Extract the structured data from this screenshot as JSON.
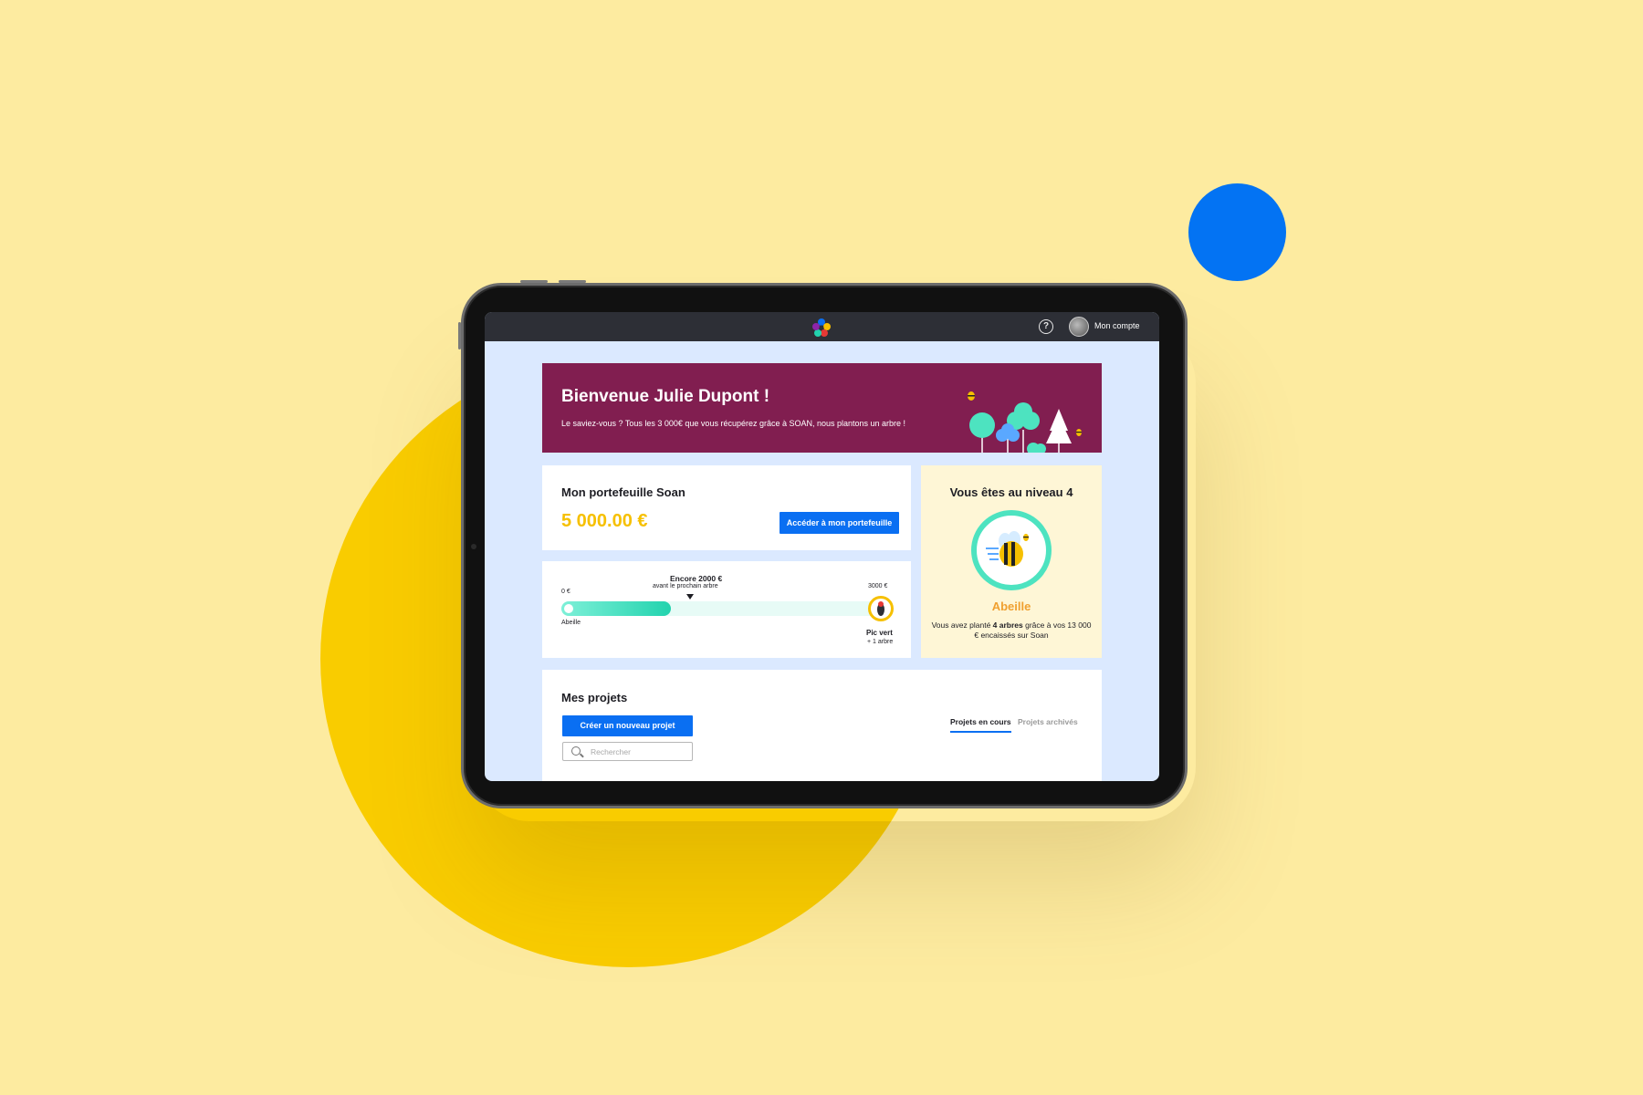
{
  "colors": {
    "background": "#fdeba0",
    "deco_yellow": "#f9cc00",
    "deco_blue": "#0373f3",
    "topbar": "#2d2f36",
    "banner": "#811e50",
    "accent_blue": "#0a6ff2",
    "amount_yellow": "#f6c000",
    "progress_green": "#22d3ae",
    "level_orange": "#f0a030",
    "level_card_bg": "#fef6d6"
  },
  "topbar": {
    "logo_icon": "soan-flower-logo",
    "help_icon": "question-circle-icon",
    "account_label": "Mon compte"
  },
  "banner": {
    "title": "Bienvenue Julie Dupont !",
    "subtitle": "Le saviez-vous ? Tous les 3 000€ que vous récupérez grâce à SOAN, nous plantons un arbre !"
  },
  "wallet": {
    "title": "Mon portefeuille Soan",
    "amount": "5 000.00 €",
    "button_label": "Accéder à mon portefeuille"
  },
  "progress": {
    "remaining_label": "Encore 2000 €",
    "remaining_sub": "avant le prochain arbre",
    "start_value": "0 €",
    "end_value": "3000 €",
    "start_name": "Abeille",
    "end_name": "Pic vert",
    "end_reward": "+ 1 arbre",
    "fill_fraction": 0.333
  },
  "level": {
    "title": "Vous êtes au niveau 4",
    "name": "Abeille",
    "desc_part1": "Vous avez planté ",
    "desc_bold": "4 arbres",
    "desc_part2": " grâce à vos 13 000 € encaissés sur Soan"
  },
  "projects": {
    "title": "Mes projets",
    "create_button": "Créer un nouveau projet",
    "search_placeholder": "Rechercher",
    "tabs": [
      {
        "label": "Projets en cours",
        "active": true
      },
      {
        "label": "Projets archivés",
        "active": false
      }
    ]
  }
}
